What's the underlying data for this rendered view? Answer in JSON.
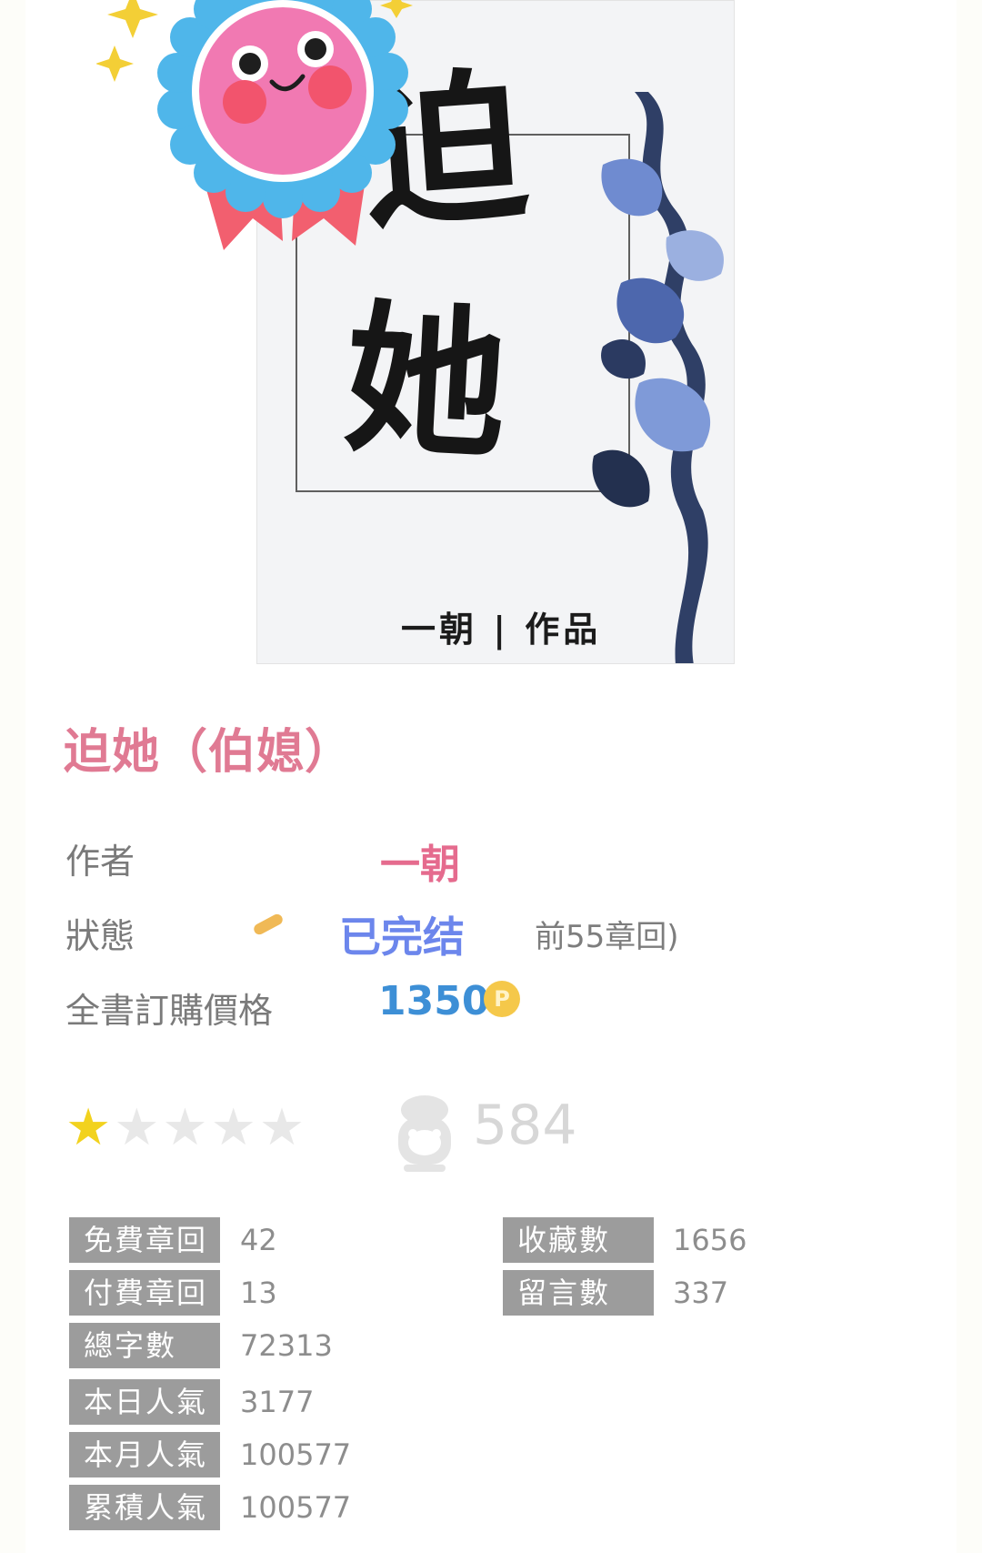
{
  "cover": {
    "title_line_1": "迫",
    "title_line_2": "她",
    "author_credit": "一朝 | 作品"
  },
  "book": {
    "title": "迫她（伯媳）"
  },
  "info": {
    "author_label": "作者",
    "author_value": "一朝",
    "status_label": "狀態",
    "status_value": "已完结",
    "status_note": "前55章回)",
    "price_label": "全書訂購價格",
    "price_value": "1350",
    "coin_symbol": "P"
  },
  "rating": {
    "stars_filled": 1,
    "stars_total": 5,
    "fans_count": "584"
  },
  "stats": {
    "left": [
      {
        "label": "免費章回",
        "value": "42"
      },
      {
        "label": "付費章回",
        "value": "13"
      },
      {
        "label": "總字數",
        "value": "72313"
      },
      {
        "label": "本日人氣",
        "value": "3177"
      },
      {
        "label": "本月人氣",
        "value": "100577"
      },
      {
        "label": "累積人氣",
        "value": "100577"
      }
    ],
    "right": [
      {
        "label": "收藏數",
        "value": "1656"
      },
      {
        "label": "留言數",
        "value": "337"
      }
    ]
  },
  "colors": {
    "title": "#e07a93",
    "author": "#e56b8e",
    "status": "#6c86ec",
    "price": "#3d8fd6",
    "star_on": "#f2d21e",
    "stat_label_bg": "#9c9c9c"
  },
  "icons": [
    "award-badge-icon",
    "star-icon",
    "fans-icon",
    "coin-icon"
  ]
}
